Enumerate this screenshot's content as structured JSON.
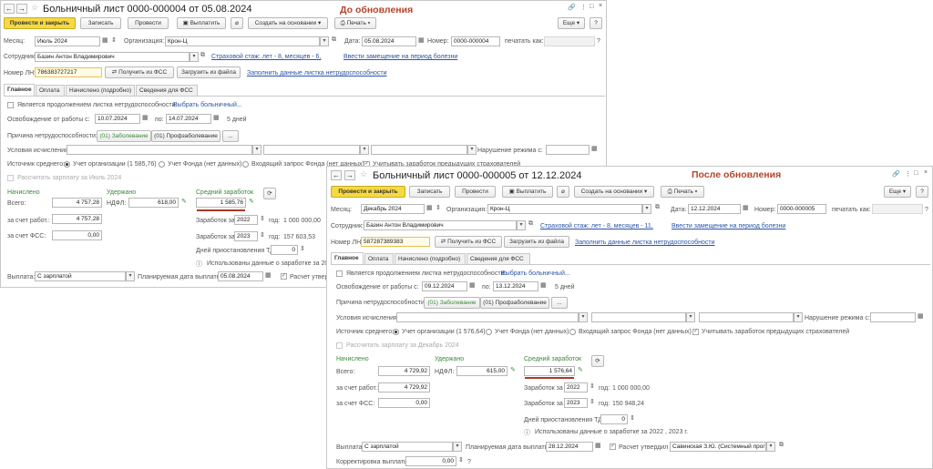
{
  "before": {
    "title": "Больничный лист 0000-000004 от 05.08.2024",
    "caption": "До обновления",
    "toolbar": {
      "post_close": "Провести и закрыть",
      "save": "Записать",
      "post": "Провести",
      "pay": "Выплатить",
      "create_based": "Создать на основании",
      "print": "Печать",
      "more": "Еще",
      "help": "?"
    },
    "month_label": "Месяц:",
    "month": "Июль 2024",
    "org_label": "Организация:",
    "org": "Крон-Ц",
    "date_label": "Дата:",
    "date": "05.08.2024",
    "number_label": "Номер:",
    "number": "0000-000004",
    "print_as_label": "печатать как:",
    "employee_label": "Сотрудник:",
    "employee": "Базин Антон Владимирович",
    "experience_link": "Страховой стаж: лет - 8, месяцев - 6,",
    "replacement_link": "Ввести замещение на период болезни",
    "ln_label": "Номер ЛН:",
    "ln": "786383727217",
    "get_fss": "Получить из ФСС",
    "load_file": "Загрузить из файла",
    "fill_link": "Заполнить данные листка нетрудоспособности",
    "tabs": [
      "Главное",
      "Оплата",
      "Начислено (подробно)",
      "Сведения для ФСС"
    ],
    "continuation": "Является продолжением листка нетрудоспособности:",
    "select_sheet": "Выбрать больничный...",
    "release_label": "Освобождение от работы с:",
    "release_from": "10.07.2024",
    "to_label": "по:",
    "release_to": "14.07.2024",
    "days": "5 дней",
    "reason_label": "Причина нетрудоспособности:",
    "reason1": "(01) Заболевание",
    "reason2": "(01) Профзаболевание",
    "ellipsis": "...",
    "conditions_label": "Условия исчисления:",
    "violation_label": "Нарушение режима с:",
    "avg_source_label": "Источник среднего:",
    "opt_org": "Учет организации (1 585,76)",
    "opt_fund": "Учет Фонда (нет данных)",
    "opt_request": "Входящий запрос Фонда (нет данных)",
    "prev_insurers": "Учитывать заработок предыдущих страхователей",
    "recalc": "Рассчитать зарплату за Июль 2024",
    "accrued_label": "Начислено",
    "withheld_label": "Удержано",
    "avg_label": "Средний заработок",
    "total_label": "Всего:",
    "total": "4 757,28",
    "ndfl_label": "НДФЛ:",
    "ndfl": "618,00",
    "avg": "1 585,76",
    "employer_label": "за счет работ.:",
    "employer": "4 757,28",
    "fss_label": "за счет ФСС:",
    "fss": "0,00",
    "earnings_label": "Заработок за",
    "year1": "2022",
    "earn1": "1 000 000,00",
    "year2": "2023",
    "earn2": "157 603,53",
    "year_label": "год:",
    "suspended_label": "Дней приостановления ТД:",
    "suspended": "0",
    "used_data": "Использованы данные о заработке за 2022",
    "payout_label": "Выплата:",
    "payout": "С зарплатой",
    "planned_label": "Планируемая дата выплаты:",
    "planned": "05.08.2024",
    "calc_approved": "Расчет утверди"
  },
  "after": {
    "title": "Больничный лист 0000-000005 от 12.12.2024",
    "caption": "После обновления",
    "toolbar": {
      "post_close": "Провести и закрыть",
      "save": "Записать",
      "post": "Провести",
      "pay": "Выплатить",
      "create_based": "Создать на основании",
      "print": "Печать",
      "more": "Еще",
      "help": "?"
    },
    "month_label": "Месяц:",
    "month": "Декабрь 2024",
    "org_label": "Организация:",
    "org": "Крон-Ц",
    "date_label": "Дата:",
    "date": "12.12.2024",
    "number_label": "Номер:",
    "number": "0000-000005",
    "print_as_label": "печатать как:",
    "employee_label": "Сотрудник:",
    "employee": "Базин Антон Владимирович",
    "experience_link": "Страховой стаж: лет - 8, месяцев - 11,",
    "replacement_link": "Ввести замещение на период болезни",
    "ln_label": "Номер ЛН:",
    "ln": "587287389383",
    "get_fss": "Получить из ФСС",
    "load_file": "Загрузить из файла",
    "fill_link": "Заполнить данные листка нетрудоспособности",
    "tabs": [
      "Главное",
      "Оплата",
      "Начислено (подробно)",
      "Сведения для ФСС"
    ],
    "continuation": "Является продолжением листка нетрудоспособности:",
    "select_sheet": "Выбрать больничный...",
    "release_label": "Освобождение от работы с:",
    "release_from": "09.12.2024",
    "to_label": "по:",
    "release_to": "13.12.2024",
    "days": "5 дней",
    "reason_label": "Причина нетрудоспособности:",
    "reason1": "(01) Заболевание",
    "reason2": "(01) Профзаболевание",
    "ellipsis": "...",
    "conditions_label": "Условия исчисления:",
    "violation_label": "Нарушение режима с:",
    "avg_source_label": "Источник среднего:",
    "opt_org": "Учет организации (1 576,64)",
    "opt_fund": "Учет Фонда (нет данных)",
    "opt_request": "Входящий запрос Фонда (нет данных)",
    "prev_insurers": "Учитывать заработок предыдущих страхователей",
    "recalc": "Рассчитать зарплату за Декабрь 2024",
    "accrued_label": "Начислено",
    "withheld_label": "Удержано",
    "avg_label": "Средний заработок",
    "total_label": "Всего:",
    "total": "4 729,92",
    "ndfl_label": "НДФЛ:",
    "ndfl": "615,00",
    "avg": "1 576,64",
    "employer_label": "за счет работ.:",
    "employer": "4 729,92",
    "fss_label": "за счет ФСС:",
    "fss": "0,00",
    "earnings_label": "Заработок за",
    "year1": "2022",
    "earn1": "1 000 000,00",
    "year2": "2023",
    "earn2": "150 948,24",
    "year_label": "год:",
    "suspended_label": "Дней приостановления ТД:",
    "suspended": "0",
    "used_data": "Использованы данные о заработке за  2022 , 2023 г.",
    "payout_label": "Выплата:",
    "payout": "С зарплатой",
    "planned_label": "Планируемая дата выплаты:",
    "planned": "28.12.2024",
    "calc_approved": "Расчет утвердил",
    "approver": "Савинская З.Ю. (Системный прог",
    "correction_label": "Корректировка выплаты:",
    "correction": "0,00"
  }
}
